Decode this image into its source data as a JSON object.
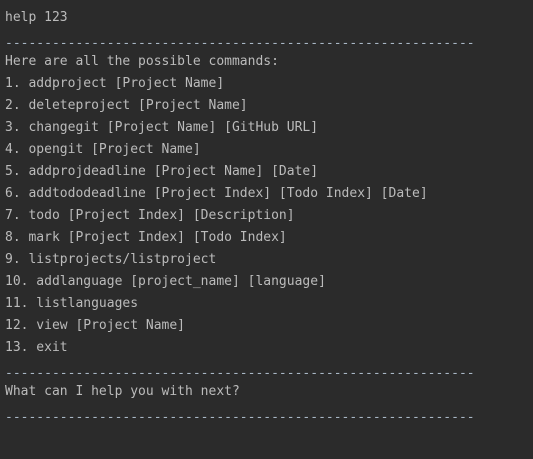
{
  "console": {
    "top_separator": "------------------------------------------------------------",
    "input_command": "help 123",
    "separator_1": "------------------------------------------------------------",
    "intro": "Here are all the possible commands:",
    "commands": [
      "1. addproject [Project Name]",
      "2. deleteproject [Project Name]",
      "3. changegit [Project Name] [GitHub URL]",
      "4. opengit [Project Name]",
      "5. addprojdeadline [Project Name] [Date]",
      "6. addtododeadline [Project Index] [Todo Index] [Date]",
      "7. todo [Project Index] [Description]",
      "8. mark [Project Index] [Todo Index]",
      "9. listprojects/listproject",
      "10. addlanguage [project_name] [language]",
      "11. listlanguages",
      "12. view [Project Name]",
      "13. exit"
    ],
    "separator_2": "------------------------------------------------------------",
    "prompt_next": "What can I help you with next?",
    "separator_3": "------------------------------------------------------------"
  }
}
